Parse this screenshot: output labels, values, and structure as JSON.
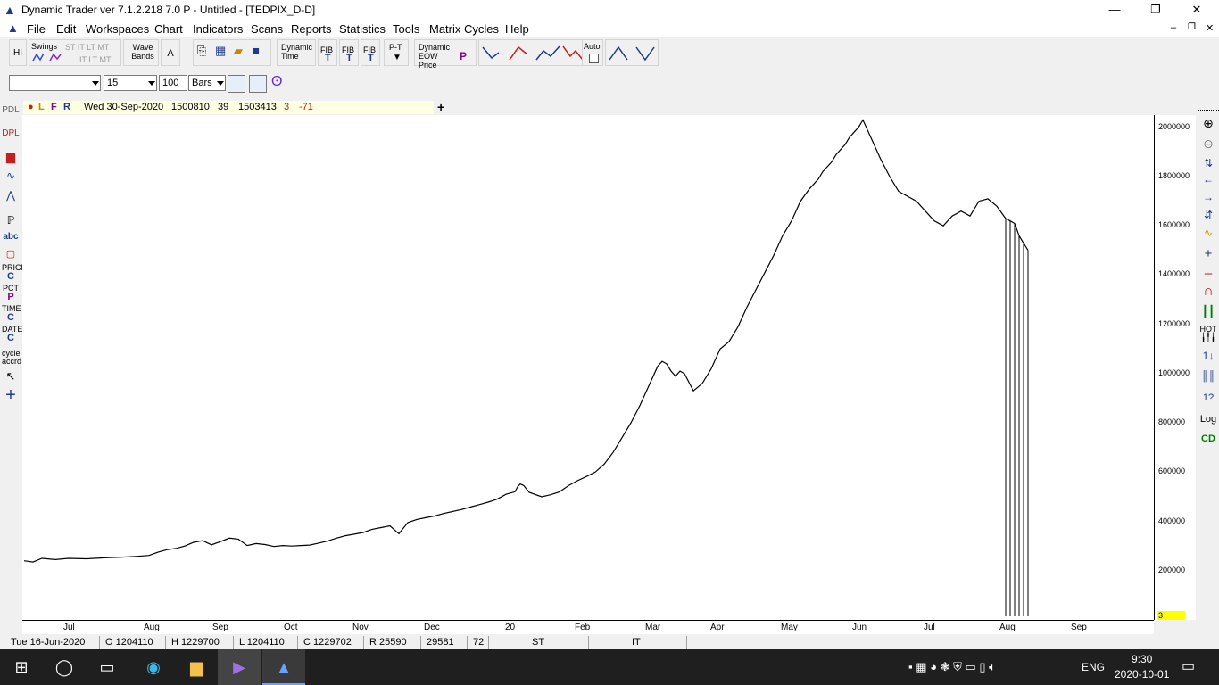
{
  "window": {
    "title": "Dynamic Trader ver 7.1.2.218 7.0 P - Untitled - [TEDPIX_D-D]",
    "minimize": "—",
    "restore": "❐",
    "close": "✕"
  },
  "menu": {
    "items": [
      "File",
      "Edit",
      "Workspaces",
      "Chart",
      "Indicators",
      "Scans",
      "Reports",
      "Statistics",
      "Tools",
      "Matrix Cycles",
      "Help"
    ],
    "mdi_min": "–",
    "mdi_restore": "❐",
    "mdi_close": "✕"
  },
  "toolbar1": {
    "hi": "HI",
    "swings": "Swings",
    "st": "ST IT LT MT",
    "it": "IT LT MT",
    "wave_bands": "Wave Bands",
    "a": "A",
    "dynamic_time": "Dynamic Time",
    "fib1": "FIB",
    "fib2": "FIB",
    "fib3": "FIB",
    "pt": "P-T",
    "dynamic_eow": "Dynamic EOW Price",
    "auto": "Auto"
  },
  "toolbar2": {
    "symbol": "",
    "period": "15",
    "bars_count": "100",
    "bars_unit": "Bars"
  },
  "left_toolbar": [
    "PDL",
    "DPL",
    "abc",
    "PRICE",
    "C",
    "PCT",
    "P",
    "TIME",
    "C",
    "DATE",
    "C",
    "cycle",
    "accrd"
  ],
  "right_toolbar": [
    "HOT",
    "Log",
    "CD"
  ],
  "infobar": {
    "l": "L",
    "f": "F",
    "r": "R",
    "date": "Wed 30-Sep-2020",
    "v1": "1500810",
    "v2": "39",
    "v3": "1503413",
    "v4": "3",
    "v5": "-71"
  },
  "chart_data": {
    "type": "line",
    "yticks": [
      "2000000",
      "1800000",
      "1600000",
      "1400000",
      "1200000",
      "1000000",
      "800000",
      "600000",
      "400000",
      "200000"
    ],
    "xticks": [
      "Jul",
      "Aug",
      "Sep",
      "Oct",
      "Nov",
      "Dec",
      "20",
      "Feb",
      "Mar",
      "Apr",
      "May",
      "Jun",
      "Jul",
      "Aug",
      "Sep"
    ],
    "ylim": [
      0,
      2050000
    ],
    "marker": "3",
    "series": [
      {
        "x": [
          0,
          10,
          20,
          35,
          50,
          70,
          90,
          110,
          125,
          140,
          150,
          160,
          170,
          180,
          190,
          200,
          210,
          220,
          230,
          240,
          250,
          260,
          270,
          280,
          290,
          300,
          310,
          320,
          330,
          340,
          350,
          360,
          370,
          380,
          390,
          400,
          410,
          420,
          430,
          440,
          450,
          460,
          470,
          480,
          490,
          500,
          510,
          520,
          530,
          540,
          550,
          553,
          556,
          560,
          566,
          580,
          590,
          600,
          610,
          620,
          630,
          640,
          650,
          660,
          670,
          680,
          690,
          700,
          705,
          710,
          715,
          720,
          725,
          730,
          735,
          740,
          750,
          760,
          770,
          780,
          790,
          800,
          810,
          820,
          830,
          840,
          850,
          860,
          870,
          880,
          890,
          895,
          900,
          905,
          910,
          915,
          920,
          925,
          930,
          935,
          940,
          950,
          960,
          970,
          980,
          990,
          1000,
          1010,
          1020,
          1030,
          1040,
          1050,
          1060,
          1070,
          1080,
          1090,
          1100,
          1105,
          1110,
          1115,
          1120,
          1125
        ],
        "y": [
          240000,
          235000,
          250000,
          245000,
          250000,
          248000,
          252000,
          255000,
          258000,
          262000,
          275000,
          285000,
          290000,
          300000,
          315000,
          322000,
          305000,
          318000,
          332000,
          328000,
          302000,
          310000,
          306000,
          298000,
          302000,
          300000,
          302000,
          304000,
          312000,
          320000,
          332000,
          342000,
          348000,
          355000,
          368000,
          375000,
          382000,
          350000,
          395000,
          408000,
          415000,
          422000,
          432000,
          440000,
          448000,
          458000,
          468000,
          478000,
          490000,
          510000,
          520000,
          540000,
          552000,
          545000,
          518000,
          500000,
          508000,
          520000,
          545000,
          565000,
          582000,
          600000,
          632000,
          680000,
          740000,
          800000,
          870000,
          950000,
          990000,
          1030000,
          1050000,
          1040000,
          1010000,
          990000,
          1010000,
          1000000,
          930000,
          960000,
          1020000,
          1100000,
          1130000,
          1190000,
          1270000,
          1340000,
          1410000,
          1480000,
          1560000,
          1620000,
          1700000,
          1750000,
          1790000,
          1820000,
          1840000,
          1860000,
          1890000,
          1910000,
          1930000,
          1960000,
          1980000,
          2000000,
          2030000,
          1950000,
          1870000,
          1800000,
          1740000,
          1720000,
          1700000,
          1660000,
          1620000,
          1600000,
          1640000,
          1660000,
          1640000,
          1700000,
          1710000,
          1680000,
          1630000,
          1620000,
          1610000,
          1560000,
          1530000,
          1500810
        ]
      }
    ]
  },
  "statusbar": {
    "date": "Tue 16-Jun-2020",
    "o": "O 1204110",
    "h": "H 1229700",
    "l": "L 1204110",
    "c": "C 1229702",
    "r": "R 25590",
    "n1": "29581",
    "n2": "72",
    "st": "ST",
    "it": "IT"
  },
  "taskbar": {
    "lang": "ENG",
    "time": "9:30",
    "date": "2020-10-01"
  }
}
